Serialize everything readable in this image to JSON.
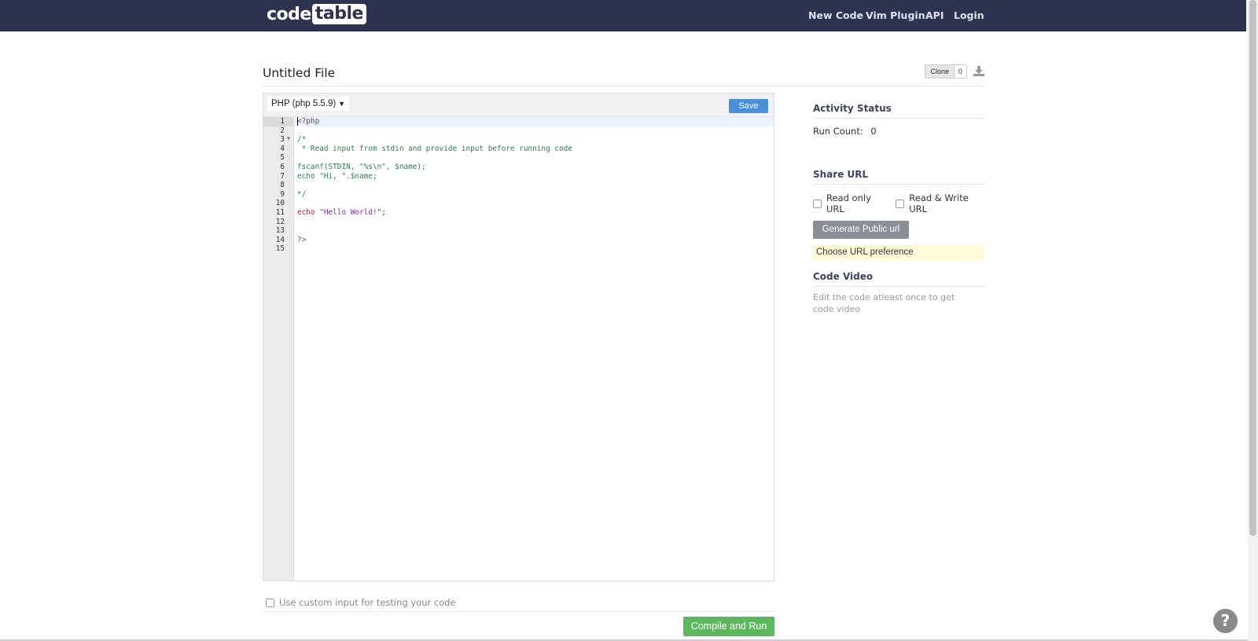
{
  "nav": {
    "logo_left": "code",
    "logo_right": "table",
    "new_code": "New Code",
    "vim_plugin": "Vim Plugin",
    "api": "API",
    "login": "Login"
  },
  "file": {
    "title": "Untitled File",
    "clone_label": "Clone",
    "clone_count": "0"
  },
  "editor": {
    "language": "PHP (php 5.5.9)",
    "save_label": "Save",
    "line_numbers": [
      "1",
      "2",
      "3",
      "4",
      "5",
      "6",
      "7",
      "8",
      "9",
      "10",
      "11",
      "12",
      "13",
      "14",
      "15"
    ],
    "code": {
      "l1": "<?php",
      "l3": "/*",
      "l4": " * Read input from stdin and provide input before running code",
      "l6": "fscanf(STDIN, \"%s\\n\", $name);",
      "l7": "echo \"Hi, \".$name;",
      "l9": "*/",
      "l11_kw": "echo ",
      "l11_str": "\"Hello World!\"",
      "l11_end": ";",
      "l14": "?>"
    }
  },
  "footer": {
    "custom_input_label": "Use custom input for testing your code",
    "compile_label": "Compile and Run"
  },
  "sidebar": {
    "activity_title": "Activity Status",
    "run_count_label": "Run Count:",
    "run_count_value": "0",
    "share_title": "Share URL",
    "read_only_label": "Read only URL",
    "read_write_label": "Read & Write URL",
    "generate_label": "Generate Public url",
    "preference_text": "Choose URL preference",
    "video_title": "Code Video",
    "video_text": "Edit the code atleast once to get code video"
  },
  "help": {
    "symbol": "?"
  },
  "colors": {
    "topbar": "#2e3350",
    "save": "#4a90d9",
    "compile": "#5cb85c",
    "generate": "#8a8f96",
    "preference_bg": "#fffbd9"
  }
}
